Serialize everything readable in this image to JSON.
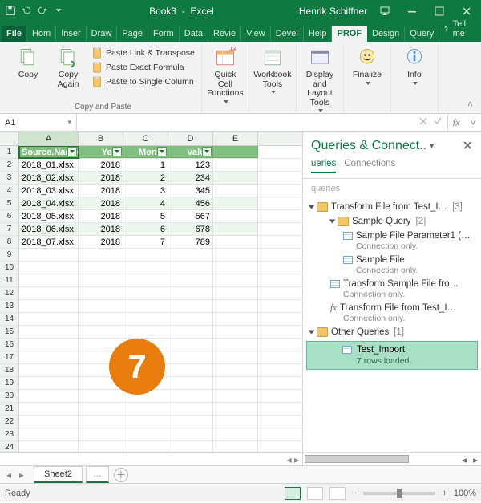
{
  "title": {
    "doc": "Book3",
    "app": "Excel",
    "user": "Henrik Schiffner"
  },
  "tabs": {
    "file": "File",
    "home": "Hom",
    "insert": "Inser",
    "draw": "Draw",
    "page": "Page",
    "form": "Form",
    "data": "Data",
    "review": "Revie",
    "view": "View",
    "devel": "Devel",
    "help": "Help",
    "prof": "PROF",
    "design": "Design",
    "query": "Query",
    "tellme": "Tell me"
  },
  "ribbon": {
    "copy": "Copy",
    "copy_again": "Copy Again",
    "paste_link": "Paste Link & Transpose",
    "paste_exact": "Paste Exact Formula",
    "paste_single": "Paste to Single Column",
    "group1": "Copy and Paste",
    "quickcell": "Quick Cell Functions",
    "workbook": "Workbook Tools",
    "display": "Display and Layout Tools",
    "finalize": "Finalize",
    "info": "Info"
  },
  "namebox": "A1",
  "fx_label": "fx",
  "table": {
    "headers": [
      "Source.Name",
      "Year",
      "Month",
      "Value"
    ],
    "rows": [
      [
        "2018_01.xlsx",
        "2018",
        "1",
        "123"
      ],
      [
        "2018_02.xlsx",
        "2018",
        "2",
        "234"
      ],
      [
        "2018_03.xlsx",
        "2018",
        "3",
        "345"
      ],
      [
        "2018_04.xlsx",
        "2018",
        "4",
        "456"
      ],
      [
        "2018_05.xlsx",
        "2018",
        "5",
        "567"
      ],
      [
        "2018_06.xlsx",
        "2018",
        "6",
        "678"
      ],
      [
        "2018_07.xlsx",
        "2018",
        "7",
        "789"
      ]
    ],
    "cols": [
      "A",
      "B",
      "C",
      "D",
      "E"
    ]
  },
  "badge": "7",
  "qpane": {
    "title": "Queries & Connect..",
    "tab1": "ueries",
    "tab2": "Connections",
    "search": "queries",
    "g1": "Transform File from Test_I…",
    "g1c": "[3]",
    "g2": "Sample Query",
    "g2c": "[2]",
    "i1": "Sample File Parameter1 (…",
    "i1s": "Connection only.",
    "i2": "Sample File",
    "i2s": "Connection only.",
    "i3": "Transform Sample File fro…",
    "i3s": "Connection only.",
    "i4": "Transform File from Test_I…",
    "i4s": "Connection only.",
    "g3": "Other Queries",
    "g3c": "[1]",
    "sel": "Test_Import",
    "sels": "7 rows loaded."
  },
  "sheettab": "Sheet2",
  "status": {
    "ready": "Ready",
    "zoom": "100%"
  }
}
